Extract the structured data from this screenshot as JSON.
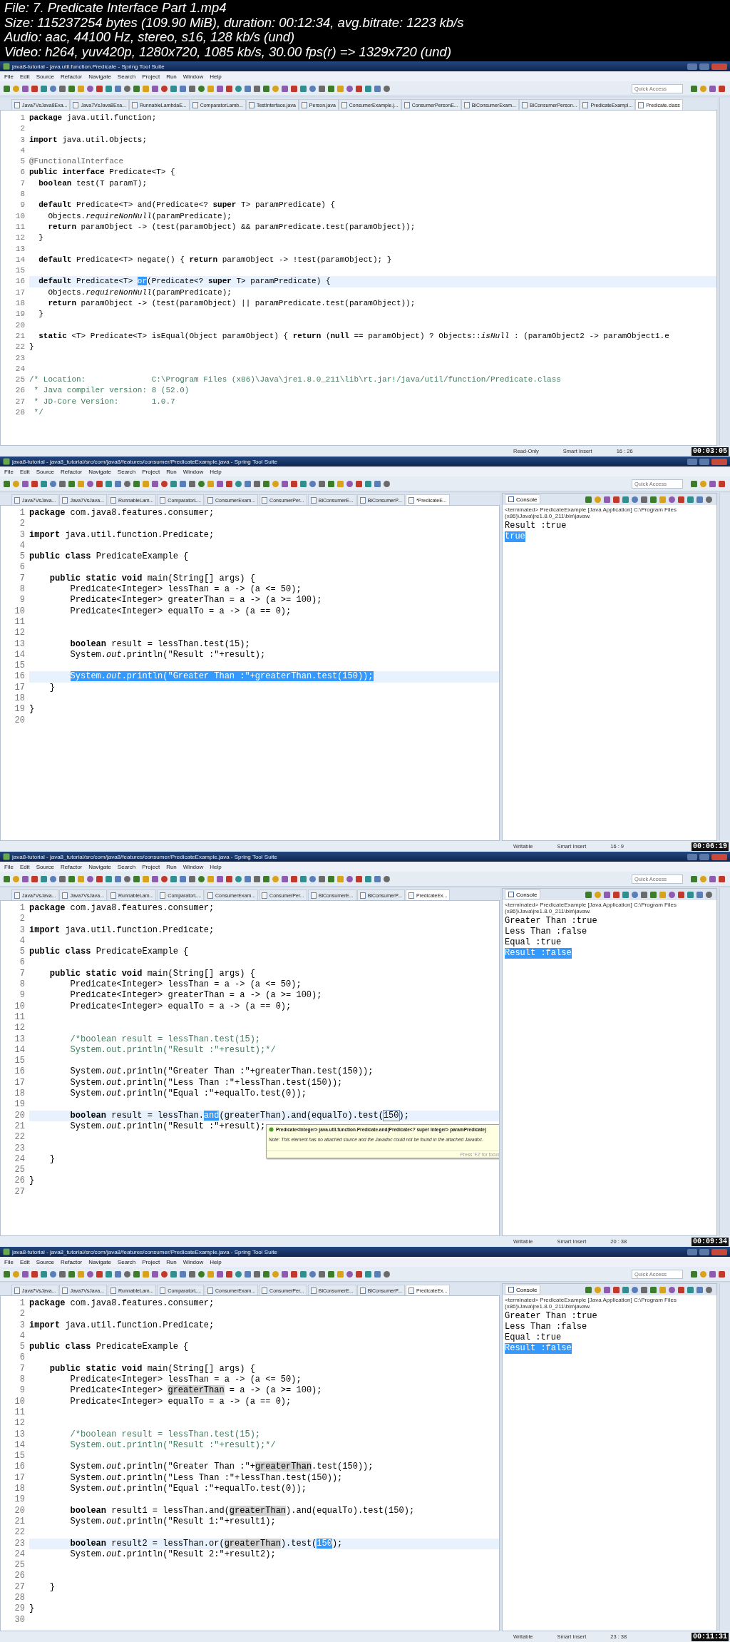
{
  "file_info": {
    "lines": [
      "File: 7. Predicate Interface Part 1.mp4",
      "Size: 115237254 bytes (109.90 MiB), duration: 00:12:34, avg.bitrate: 1223 kb/s",
      "Audio: aac, 44100 Hz, stereo, s16, 128 kb/s (und)",
      "Video: h264, yuv420p, 1280x720, 1085 kb/s, 30.00 fps(r) => 1329x720 (und)"
    ]
  },
  "frames": [
    {
      "window_title": "java8-tutorial - java.util.function.Predicate - Spring Tool Suite",
      "menu": [
        "File",
        "Edit",
        "Source",
        "Refactor",
        "Navigate",
        "Search",
        "Project",
        "Run",
        "Window",
        "Help"
      ],
      "quick_access": {
        "placeholder": "Quick Access"
      },
      "tabs": [
        {
          "label": "Java7VsJava8Exa...",
          "selected": false
        },
        {
          "label": "Java7VsJava8Exa...",
          "selected": false
        },
        {
          "label": "RunnableLambdaE...",
          "selected": false
        },
        {
          "label": "ComparatorLamb...",
          "selected": false
        },
        {
          "label": "TestInterface.java",
          "selected": false
        },
        {
          "label": "Person.java",
          "selected": false
        },
        {
          "label": "ConsumerExample.j...",
          "selected": false
        },
        {
          "label": "ConsumerPersonE...",
          "selected": false
        },
        {
          "label": "BiConsumerExam...",
          "selected": false
        },
        {
          "label": "BiConsumerPerson...",
          "selected": false
        },
        {
          "label": "PredicateExampl...",
          "selected": false
        },
        {
          "label": "Predicate.class",
          "selected": true
        }
      ],
      "editor": {
        "lines": [
          {
            "n": "1",
            "kind": "code",
            "current": false,
            "code": "**package** java.util.function;"
          },
          {
            "n": "2",
            "kind": "blank",
            "current": false
          },
          {
            "n": "3",
            "kind": "code",
            "current": false,
            "code": "**import** java.util.Objects;"
          },
          {
            "n": "4",
            "kind": "blank",
            "current": false
          },
          {
            "n": "5",
            "kind": "annotation",
            "current": false,
            "code": "@FunctionalInterface"
          },
          {
            "n": "6",
            "kind": "code",
            "current": false,
            "code": "**public** **interface** Predicate<T> {"
          },
          {
            "n": "7",
            "kind": "code",
            "current": false,
            "code": "  **boolean** test(T paramT);"
          },
          {
            "n": "8",
            "kind": "blank",
            "current": false
          },
          {
            "n": "9",
            "kind": "code",
            "current": false,
            "code": "  **default** Predicate<T> and(Predicate<? **super** T> paramPredicate) {"
          },
          {
            "n": "10",
            "kind": "code",
            "current": false,
            "code": "    Objects.*requireNonNull*(paramPredicate);"
          },
          {
            "n": "11",
            "kind": "code",
            "current": false,
            "code": "    **return** paramObject -> (test(paramObject) && paramPredicate.test(paramObject));"
          },
          {
            "n": "12",
            "kind": "code",
            "current": false,
            "code": "  }"
          },
          {
            "n": "13",
            "kind": "blank",
            "current": false
          },
          {
            "n": "14",
            "kind": "code",
            "current": false,
            "code": "  **default** Predicate<T> negate() { **return** paramObject -> !test(paramObject); }"
          },
          {
            "n": "15",
            "kind": "blank",
            "current": false
          },
          {
            "n": "16",
            "kind": "code",
            "current": true,
            "parts": [
              {
                "code": "  **default** Predicate<T> ",
                "kind": "plain"
              },
              {
                "code": "or",
                "kind": "selected"
              },
              {
                "code": "(Predicate<? **super** T> paramPredicate) {",
                "kind": "plain"
              }
            ]
          },
          {
            "n": "17",
            "kind": "code",
            "current": false,
            "code": "    Objects.*requireNonNull*(paramPredicate);"
          },
          {
            "n": "18",
            "kind": "code",
            "current": false,
            "code": "    **return** paramObject -> (test(paramObject) || paramPredicate.test(paramObject));"
          },
          {
            "n": "19",
            "kind": "code",
            "current": false,
            "code": "  }"
          },
          {
            "n": "20",
            "kind": "blank",
            "current": false
          },
          {
            "n": "21",
            "kind": "code",
            "current": false,
            "code": "  **static** <T> Predicate<T> isEqual(Object paramObject) { **return** (**null** == paramObject) ? Objects::*isNull* : (paramObject2 -> paramObject1.e"
          },
          {
            "n": "22",
            "kind": "code",
            "current": false,
            "code": "}"
          },
          {
            "n": "23",
            "kind": "blank",
            "current": false
          },
          {
            "n": "24",
            "kind": "blank",
            "current": false
          },
          {
            "n": "25",
            "kind": "comment",
            "current": false,
            "code": "/* Location:              C:\\Program Files (x86)\\Java\\jre1.8.0_211\\lib\\rt.jar!/java/util/function/Predicate.class"
          },
          {
            "n": "26",
            "kind": "comment",
            "current": false,
            "code": " * Java compiler version: 8 (52.0)"
          },
          {
            "n": "27",
            "kind": "comment",
            "current": false,
            "code": " * JD-Core Version:       1.0.7"
          },
          {
            "n": "28",
            "kind": "comment",
            "current": false,
            "code": " */"
          }
        ]
      },
      "status_bar": [
        "Read-Only",
        "Smart Insert",
        "16 : 26"
      ],
      "timestamp": "00:03:05"
    },
    {
      "window_title": "java8-tutorial - java8_tutorial/src/com/java8/features/consumer/PredicateExample.java - Spring Tool Suite",
      "menu": [
        "File",
        "Edit",
        "Source",
        "Refactor",
        "Navigate",
        "Search",
        "Project",
        "Run",
        "Window",
        "Help"
      ],
      "quick_access": {
        "placeholder": "Quick Access"
      },
      "tabs": [
        {
          "label": "Java7VsJava...",
          "selected": false
        },
        {
          "label": "Java7VsJava...",
          "selected": false
        },
        {
          "label": "RunnableLam...",
          "selected": false
        },
        {
          "label": "ComparatorL...",
          "selected": false
        },
        {
          "label": "ConsumerExam...",
          "selected": false
        },
        {
          "label": "ConsumerPer...",
          "selected": false
        },
        {
          "label": "BiConsumerE...",
          "selected": false
        },
        {
          "label": "BiConsumerP...",
          "selected": false
        },
        {
          "label": "*PredicateE...",
          "selected": true
        }
      ],
      "editor": {
        "lines": [
          {
            "n": "1",
            "kind": "code",
            "current": false,
            "code": "**package** com.java8.features.consumer;"
          },
          {
            "n": "2",
            "kind": "blank",
            "current": false
          },
          {
            "n": "3",
            "kind": "code",
            "current": false,
            "code": "**import** java.util.function.Predicate;"
          },
          {
            "n": "4",
            "kind": "blank",
            "current": false
          },
          {
            "n": "5",
            "kind": "code",
            "current": false,
            "code": "**public** **class** PredicateExample {"
          },
          {
            "n": "6",
            "kind": "blank",
            "current": false
          },
          {
            "n": "7",
            "kind": "code",
            "current": false,
            "code": "    **public** **static** **void** main(String[] args) {"
          },
          {
            "n": "8",
            "kind": "code",
            "current": false,
            "code": "        Predicate<Integer> lessThan = a -> (a <= 50);"
          },
          {
            "n": "9",
            "kind": "code",
            "current": false,
            "code": "        Predicate<Integer> greaterThan = a -> (a >= 100);"
          },
          {
            "n": "10",
            "kind": "code",
            "current": false,
            "code": "        Predicate<Integer> equalTo = a -> (a == 0);"
          },
          {
            "n": "11",
            "kind": "blank",
            "current": false
          },
          {
            "n": "12",
            "kind": "blank",
            "current": false
          },
          {
            "n": "13",
            "kind": "code",
            "current": false,
            "code": "        **boolean** result = lessThan.test(15);"
          },
          {
            "n": "14",
            "kind": "code",
            "current": false,
            "code": "        System.*out*.println(\"Result :\"+result);"
          },
          {
            "n": "15",
            "kind": "blank",
            "current": false
          },
          {
            "n": "16",
            "kind": "code",
            "current": true,
            "parts": [
              {
                "code": "        System.*out*.println(\"Greater Than :\"+greaterThan.test(150));",
                "kind": "selected"
              }
            ]
          },
          {
            "n": "17",
            "kind": "code",
            "current": false,
            "code": "    }"
          },
          {
            "n": "18",
            "kind": "blank",
            "current": false
          },
          {
            "n": "19",
            "kind": "code",
            "current": false,
            "code": "}"
          },
          {
            "n": "20",
            "kind": "blank",
            "current": false
          }
        ]
      },
      "console": {
        "tab": "Console",
        "process": "<terminated> PredicateExample [Java Application] C:\\Program Files (x86)\\Java\\jre1.8.0_211\\bin\\javaw.",
        "lines": [
          {
            "text": "Result :true",
            "selected": false
          },
          {
            "text": "true",
            "selected": true
          }
        ]
      },
      "status_bar": [
        "Writable",
        "Smart Insert",
        "16 : 9"
      ],
      "timestamp": "00:06:19"
    },
    {
      "window_title": "java8-tutorial - java8_tutorial/src/com/java8/features/consumer/PredicateExample.java - Spring Tool Suite",
      "menu": [
        "File",
        "Edit",
        "Source",
        "Refactor",
        "Navigate",
        "Search",
        "Project",
        "Run",
        "Window",
        "Help"
      ],
      "quick_access": {
        "placeholder": "Quick Access"
      },
      "tabs": [
        {
          "label": "Java7VsJava...",
          "selected": false
        },
        {
          "label": "Java7VsJava...",
          "selected": false
        },
        {
          "label": "RunnableLam...",
          "selected": false
        },
        {
          "label": "ComparatorL...",
          "selected": false
        },
        {
          "label": "ConsumerExam...",
          "selected": false
        },
        {
          "label": "ConsumerPer...",
          "selected": false
        },
        {
          "label": "BiConsumerE...",
          "selected": false
        },
        {
          "label": "BiConsumerP...",
          "selected": false
        },
        {
          "label": "PredicateEx...",
          "selected": true
        }
      ],
      "editor": {
        "lines": [
          {
            "n": "1",
            "kind": "code",
            "current": false,
            "code": "**package** com.java8.features.consumer;"
          },
          {
            "n": "2",
            "kind": "blank",
            "current": false
          },
          {
            "n": "3",
            "kind": "code",
            "current": false,
            "code": "**import** java.util.function.Predicate;"
          },
          {
            "n": "4",
            "kind": "blank",
            "current": false
          },
          {
            "n": "5",
            "kind": "code",
            "current": false,
            "code": "**public** **class** PredicateExample {"
          },
          {
            "n": "6",
            "kind": "blank",
            "current": false
          },
          {
            "n": "7",
            "kind": "code",
            "current": false,
            "code": "    **public** **static** **void** main(String[] args) {"
          },
          {
            "n": "8",
            "kind": "code",
            "current": false,
            "code": "        Predicate<Integer> lessThan = a -> (a <= 50);"
          },
          {
            "n": "9",
            "kind": "code",
            "current": false,
            "code": "        Predicate<Integer> greaterThan = a -> (a >= 100);"
          },
          {
            "n": "10",
            "kind": "code",
            "current": false,
            "code": "        Predicate<Integer> equalTo = a -> (a == 0);"
          },
          {
            "n": "11",
            "kind": "blank",
            "current": false
          },
          {
            "n": "12",
            "kind": "blank",
            "current": false
          },
          {
            "n": "13",
            "kind": "comment",
            "current": false,
            "code": "        /*boolean result = lessThan.test(15);"
          },
          {
            "n": "14",
            "kind": "comment",
            "current": false,
            "code": "        System.out.println(\"Result :\"+result);*/"
          },
          {
            "n": "15",
            "kind": "blank",
            "current": false
          },
          {
            "n": "16",
            "kind": "code",
            "current": false,
            "code": "        System.*out*.println(\"Greater Than :\"+greaterThan.test(150));"
          },
          {
            "n": "17",
            "kind": "code",
            "current": false,
            "code": "        System.*out*.println(\"Less Than :\"+lessThan.test(150));"
          },
          {
            "n": "18",
            "kind": "code",
            "current": false,
            "code": "        System.*out*.println(\"Equal :\"+equalTo.test(0));"
          },
          {
            "n": "19",
            "kind": "blank",
            "current": false
          },
          {
            "n": "20",
            "kind": "code",
            "current": true,
            "parts": [
              {
                "code": "        **boolean** result = lessThan.",
                "kind": "plain"
              },
              {
                "code": "and",
                "kind": "selected"
              },
              {
                "code": "(greaterThan).and(equalTo).test(",
                "kind": "plain"
              },
              {
                "code": "150",
                "kind": "boxed"
              },
              {
                "code": ");",
                "kind": "plain"
              }
            ]
          },
          {
            "n": "21",
            "kind": "code",
            "current": false,
            "code": "        System.*out*.println(\"Result :\"+result);"
          },
          {
            "n": "22",
            "kind": "blank",
            "current": false
          },
          {
            "n": "23",
            "kind": "blank",
            "current": false
          },
          {
            "n": "24",
            "kind": "code",
            "current": false,
            "code": "    }"
          },
          {
            "n": "25",
            "kind": "blank",
            "current": false
          },
          {
            "n": "26",
            "kind": "code",
            "current": false,
            "code": "}"
          },
          {
            "n": "27",
            "kind": "blank",
            "current": false
          }
        ]
      },
      "tooltip": {
        "signature": "Predicate<Integer> java.util.function.Predicate.and(Predicate<? super Integer> paramPredicate)",
        "note": "Note: This element has no attached source and the Javadoc could not be found in the attached Javadoc.",
        "hint": "Press 'F2' for focus"
      },
      "console": {
        "tab": "Console",
        "process": "<terminated> PredicateExample [Java Application] C:\\Program Files (x86)\\Java\\jre1.8.0_211\\bin\\javaw.",
        "lines": [
          {
            "text": "Greater Than :true",
            "selected": false
          },
          {
            "text": "Less Than :false",
            "selected": false
          },
          {
            "text": "Equal :true",
            "selected": false
          },
          {
            "text": "Result :false",
            "selected": true
          }
        ]
      },
      "status_bar": [
        "Writable",
        "Smart Insert",
        "20 : 38"
      ],
      "timestamp": "00:09:34"
    },
    {
      "window_title": "java8-tutorial - java8_tutorial/src/com/java8/features/consumer/PredicateExample.java - Spring Tool Suite",
      "menu": [
        "File",
        "Edit",
        "Source",
        "Refactor",
        "Navigate",
        "Search",
        "Project",
        "Run",
        "Window",
        "Help"
      ],
      "quick_access": {
        "placeholder": "Quick Access"
      },
      "tabs": [
        {
          "label": "Java7VsJava...",
          "selected": false
        },
        {
          "label": "Java7VsJava...",
          "selected": false
        },
        {
          "label": "RunnableLam...",
          "selected": false
        },
        {
          "label": "ComparatorL...",
          "selected": false
        },
        {
          "label": "ConsumerExam...",
          "selected": false
        },
        {
          "label": "ConsumerPer...",
          "selected": false
        },
        {
          "label": "BiConsumerE...",
          "selected": false
        },
        {
          "label": "BiConsumerP...",
          "selected": false
        },
        {
          "label": "PredicateEx...",
          "selected": true
        }
      ],
      "editor": {
        "lines": [
          {
            "n": "1",
            "kind": "code",
            "current": false,
            "code": "**package** com.java8.features.consumer;"
          },
          {
            "n": "2",
            "kind": "blank",
            "current": false
          },
          {
            "n": "3",
            "kind": "code",
            "current": false,
            "code": "**import** java.util.function.Predicate;"
          },
          {
            "n": "4",
            "kind": "blank",
            "current": false
          },
          {
            "n": "5",
            "kind": "code",
            "current": false,
            "code": "**public** **class** PredicateExample {"
          },
          {
            "n": "6",
            "kind": "blank",
            "current": false
          },
          {
            "n": "7",
            "kind": "code",
            "current": false,
            "code": "    **public** **static** **void** main(String[] args) {"
          },
          {
            "n": "8",
            "kind": "code",
            "current": false,
            "code": "        Predicate<Integer> lessThan = a -> (a <= 50);"
          },
          {
            "n": "9",
            "kind": "code",
            "current": false,
            "parts": [
              {
                "code": "        Predicate<Integer> ",
                "kind": "plain"
              },
              {
                "code": "greaterThan",
                "kind": "occurrence"
              },
              {
                "code": " = a -> (a >= 100);",
                "kind": "plain"
              }
            ]
          },
          {
            "n": "10",
            "kind": "code",
            "current": false,
            "code": "        Predicate<Integer> equalTo = a -> (a == 0);"
          },
          {
            "n": "11",
            "kind": "blank",
            "current": false
          },
          {
            "n": "12",
            "kind": "blank",
            "current": false
          },
          {
            "n": "13",
            "kind": "comment",
            "current": false,
            "code": "        /*boolean result = lessThan.test(15);"
          },
          {
            "n": "14",
            "kind": "comment",
            "current": false,
            "code": "        System.out.println(\"Result :\"+result);*/"
          },
          {
            "n": "15",
            "kind": "blank",
            "current": false
          },
          {
            "n": "16",
            "kind": "code",
            "current": false,
            "parts": [
              {
                "code": "        System.*out*.println(\"Greater Than :\"+",
                "kind": "plain"
              },
              {
                "code": "greaterThan",
                "kind": "occurrence"
              },
              {
                "code": ".test(150));",
                "kind": "plain"
              }
            ]
          },
          {
            "n": "17",
            "kind": "code",
            "current": false,
            "code": "        System.*out*.println(\"Less Than :\"+lessThan.test(150));"
          },
          {
            "n": "18",
            "kind": "code",
            "current": false,
            "code": "        System.*out*.println(\"Equal :\"+equalTo.test(0));"
          },
          {
            "n": "19",
            "kind": "blank",
            "current": false
          },
          {
            "n": "20",
            "kind": "code",
            "current": false,
            "parts": [
              {
                "code": "        **boolean** result1 = lessThan.and(",
                "kind": "plain"
              },
              {
                "code": "greaterThan",
                "kind": "occurrence"
              },
              {
                "code": ").and(equalTo).test(150);",
                "kind": "plain"
              }
            ]
          },
          {
            "n": "21",
            "kind": "code",
            "current": false,
            "code": "        System.*out*.println(\"Result 1:\"+result1);"
          },
          {
            "n": "22",
            "kind": "blank",
            "current": false
          },
          {
            "n": "23",
            "kind": "code",
            "current": true,
            "parts": [
              {
                "code": "        **boolean** result2 = lessThan.or(",
                "kind": "plain"
              },
              {
                "code": "greaterThan",
                "kind": "occurrence"
              },
              {
                "code": ").test(",
                "kind": "plain"
              },
              {
                "code": "150",
                "kind": "selected"
              },
              {
                "code": ");",
                "kind": "plain"
              }
            ]
          },
          {
            "n": "24",
            "kind": "code",
            "current": false,
            "code": "        System.*out*.println(\"Result 2:\"+result2);"
          },
          {
            "n": "25",
            "kind": "blank",
            "current": false
          },
          {
            "n": "26",
            "kind": "blank",
            "current": false
          },
          {
            "n": "27",
            "kind": "code",
            "current": false,
            "code": "    }"
          },
          {
            "n": "28",
            "kind": "blank",
            "current": false
          },
          {
            "n": "29",
            "kind": "code",
            "current": false,
            "code": "}"
          },
          {
            "n": "30",
            "kind": "blank",
            "current": false
          }
        ]
      },
      "console": {
        "tab": "Console",
        "process": "<terminated> PredicateExample [Java Application] C:\\Program Files (x86)\\Java\\jre1.8.0_211\\bin\\javaw.",
        "lines": [
          {
            "text": "Greater Than :true",
            "selected": false
          },
          {
            "text": "Less Than :false",
            "selected": false
          },
          {
            "text": "Equal :true",
            "selected": false
          },
          {
            "text": "Result :false",
            "selected": true
          }
        ]
      },
      "status_bar": [
        "Writable",
        "Smart Insert",
        "23 : 38"
      ],
      "timestamp": "00:11:31"
    }
  ]
}
